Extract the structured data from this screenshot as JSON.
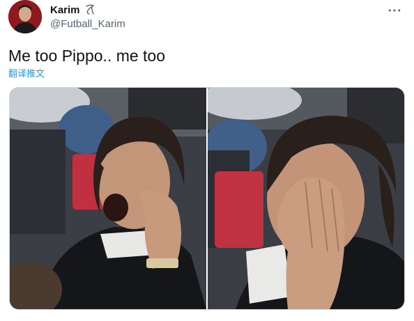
{
  "author": {
    "display_name": "Karim",
    "handle": "@Futball_Karim",
    "avatar_icon": "avatar-photo",
    "badge_icon": "scribble-signature-icon"
  },
  "menu_icon": "more-horizontal-icon",
  "tweet": {
    "text": "Me too Pippo.. me too",
    "translate_label": "翻译推文"
  },
  "media": {
    "photos": [
      {
        "icon": "photo-man-yawning"
      },
      {
        "icon": "photo-man-rubbing-eyes"
      }
    ]
  },
  "colors": {
    "text_primary": "#0f1419",
    "text_secondary": "#536471",
    "link": "#1d9bf0"
  }
}
